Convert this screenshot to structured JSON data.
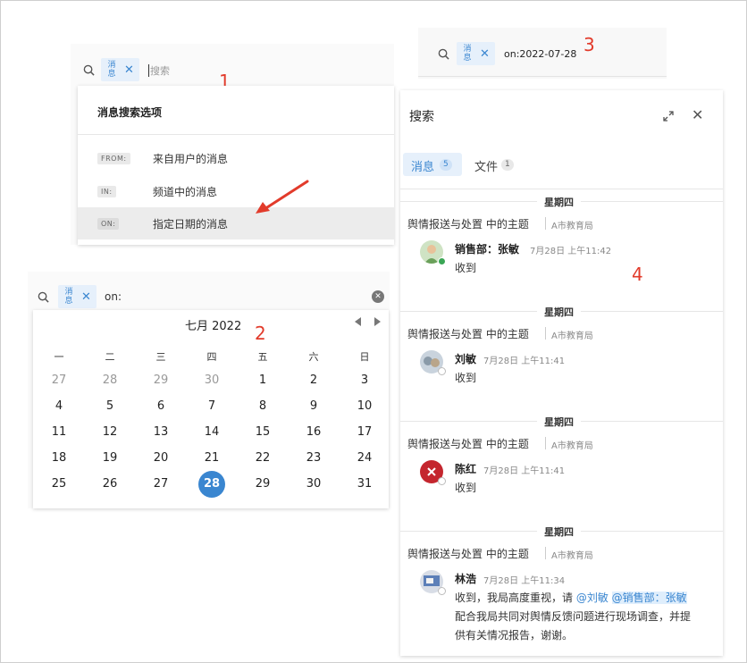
{
  "annotations": [
    "1",
    "2",
    "3",
    "4"
  ],
  "tag_label_line1": "消",
  "tag_label_line2": "息",
  "panel1": {
    "search_placeholder": "搜索",
    "menu_title": "消息搜索选项",
    "options": [
      {
        "key": "FROM:",
        "label": "来自用户的消息"
      },
      {
        "key": "IN:",
        "label": "频道中的消息"
      },
      {
        "key": "ON:",
        "label": "指定日期的消息"
      }
    ]
  },
  "panel2": {
    "search_value": "on:",
    "month_title": "七月 2022",
    "weekdays": [
      "一",
      "二",
      "三",
      "四",
      "五",
      "六",
      "日"
    ],
    "days": [
      [
        "27",
        "28",
        "29",
        "30",
        "1",
        "2",
        "3"
      ],
      [
        "4",
        "5",
        "6",
        "7",
        "8",
        "9",
        "10"
      ],
      [
        "11",
        "12",
        "13",
        "14",
        "15",
        "16",
        "17"
      ],
      [
        "18",
        "19",
        "20",
        "21",
        "22",
        "23",
        "24"
      ],
      [
        "25",
        "26",
        "27",
        "28",
        "29",
        "30",
        "31"
      ]
    ],
    "selected_day": "28"
  },
  "panel3": {
    "search_value": "on:2022-07-28"
  },
  "panel4": {
    "title": "搜索",
    "tabs": [
      {
        "label": "消息",
        "count": "5"
      },
      {
        "label": "文件",
        "count": "1"
      }
    ],
    "results": [
      {
        "day": "星期四",
        "topic": "舆情报送与处置 中的主题",
        "channel": "A市教育局",
        "user": "销售部：张敏",
        "time": "7月28日 上午11:42",
        "lines": [
          "收到"
        ]
      },
      {
        "day": "星期四",
        "topic": "舆情报送与处置 中的主题",
        "channel": "A市教育局",
        "user": "刘敏",
        "time": "7月28日 上午11:41",
        "lines": [
          "收到"
        ]
      },
      {
        "day": "星期四",
        "topic": "舆情报送与处置 中的主题",
        "channel": "A市教育局",
        "user": "陈红",
        "time": "7月28日 上午11:41",
        "lines": [
          "收到"
        ]
      },
      {
        "day": "星期四",
        "topic": "舆情报送与处置 中的主题",
        "channel": "A市教育局",
        "user": "林浩",
        "time": "7月28日 上午11:34",
        "line1_prefix": "收到，我局高度重视，请 ",
        "mention1": "@刘敏",
        "mention2": "@销售部：张敏",
        "lines": [
          "配合我局共同对舆情反馈问题进行现场调查，并提",
          "供有关情况报告，谢谢。"
        ]
      }
    ]
  },
  "colors": {
    "accent": "#3a86d0",
    "annotation": "#e23b2b",
    "online": "#3aa655"
  }
}
